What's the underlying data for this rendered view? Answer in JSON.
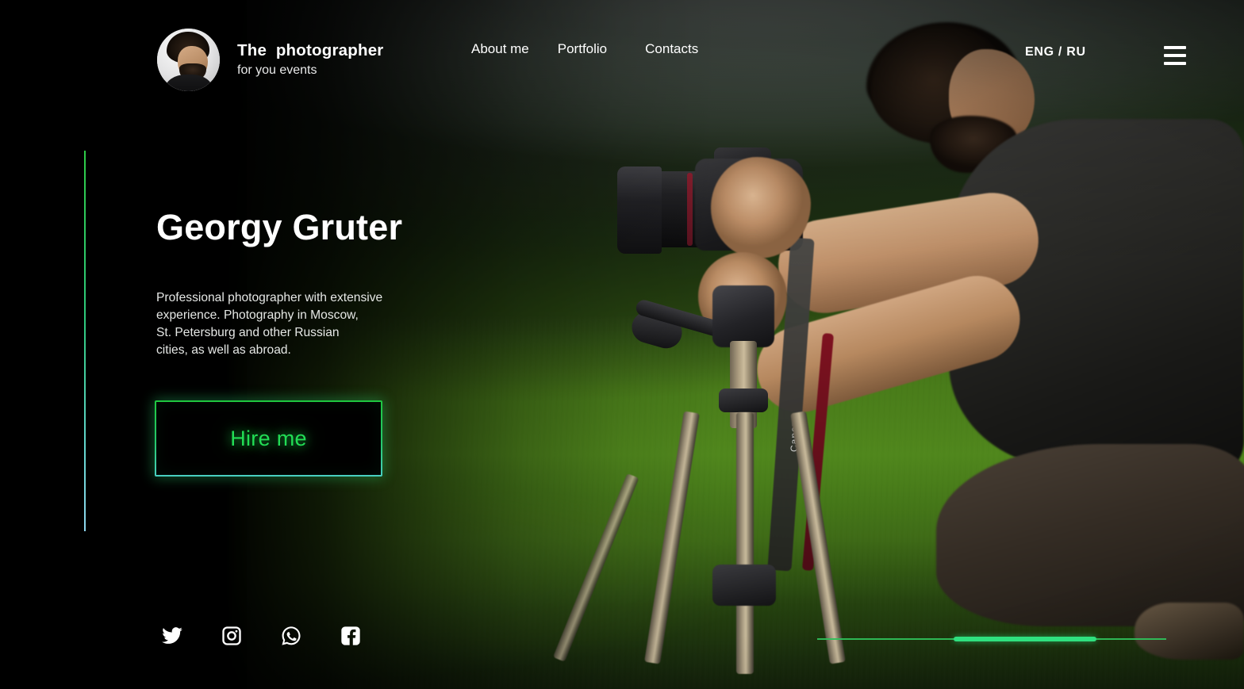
{
  "header": {
    "brand": {
      "avatar_alt": "photographer-portrait",
      "title": "The  photographer",
      "subtitle": "for you events"
    },
    "nav": [
      {
        "label": "About me"
      },
      {
        "label": "Portfolio"
      },
      {
        "label": "Contacts"
      }
    ],
    "language_switcher": "ENG / RU",
    "menu_icon": "hamburger-icon"
  },
  "hero": {
    "name": "Georgy Gruter",
    "description": "Professional photographer with extensive\nexperience. Photography in Moscow,\nSt. Petersburg and  other Russian\ncities, as well as abroad.",
    "cta_label": "Hire me"
  },
  "socials": [
    {
      "name": "twitter",
      "label": "Twitter"
    },
    {
      "name": "instagram",
      "label": "Instagram"
    },
    {
      "name": "whatsapp",
      "label": "WhatsApp"
    },
    {
      "name": "facebook",
      "label": "Facebook"
    }
  ],
  "slider": {
    "track_label": "slide-progress",
    "active_start_pct": 39,
    "active_width_pct": 41
  },
  "background": {
    "scene": "photographer-with-dslr-on-tripod-in-green-field"
  },
  "colors": {
    "accent_green": "#22dd55",
    "accent_cyan": "#8fd6ef",
    "slider_active": "#2fe07f",
    "slider_track": "#2fbf5a",
    "text_primary": "#ffffff",
    "background": "#000000"
  }
}
